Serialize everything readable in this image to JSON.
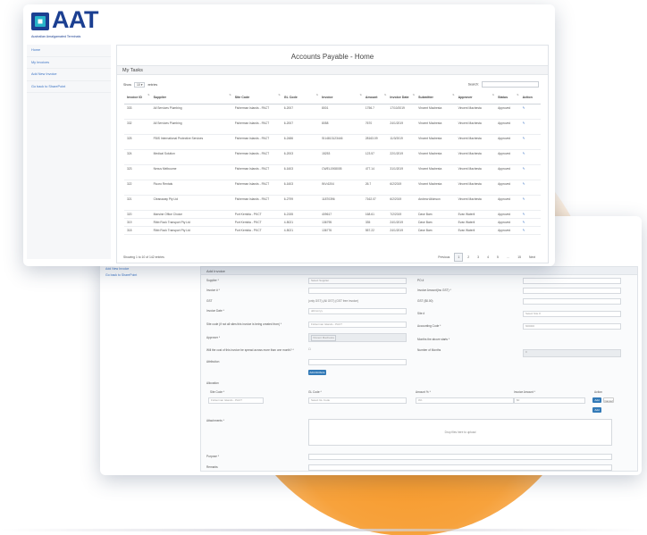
{
  "brand": {
    "name": "AAT",
    "tagline": "Australian Amalgamated Terminals",
    "colors": {
      "navy": "#1b3f91",
      "teal": "#27b3c9",
      "accent": "#f6941f"
    }
  },
  "front": {
    "sidebar": {
      "items": [
        {
          "label": "Home"
        },
        {
          "label": "My Invoices"
        },
        {
          "label": "Add New Invoice"
        },
        {
          "label": "Go back to SharePoint"
        }
      ]
    },
    "page_title": "Accounts Payable - Home",
    "section_title": "My Tasks",
    "show_label": "Show",
    "show_value": "10",
    "entries_label": "entries",
    "search_label": "Search:",
    "columns": [
      "Invoice ID",
      "Supplier",
      "Site Code",
      "GL Code",
      "Invoice",
      "Amount",
      "Invoice Date",
      "Submitter",
      "Approver",
      "Status",
      "Action"
    ],
    "rows": [
      {
        "id": "333",
        "supplier": "All Services Plumbing",
        "site": "Fisherman Islands - PACT",
        "gl": "6-2007",
        "invoice": "8001",
        "amount": "1756.7",
        "date": "17/10/2019",
        "submitter": "Vincent Machesta",
        "approver": "Vincent Machesta",
        "status": "Approved",
        "tall": true
      },
      {
        "id": "332",
        "supplier": "All Services Plumbing",
        "site": "Fisherman Islands - PACT",
        "gl": "6-2007",
        "invoice": "8058",
        "amount": "7670",
        "date": "24/1/2019",
        "submitter": "Vincent Machesta",
        "approver": "Vincent Machesta",
        "status": "Approved",
        "tall": true
      },
      {
        "id": "325",
        "supplier": "FBIS International Protective Services",
        "site": "Fisherman Islands - PACT",
        "gl": "6-2486",
        "invoice": "SI14813123446",
        "amount": "28163.09",
        "date": "11/3/2019",
        "submitter": "Vincent Machesta",
        "approver": "Vincent Machesta",
        "status": "Approved",
        "tall": true
      },
      {
        "id": "324",
        "supplier": "Medical Solution",
        "site": "Fisherman Islands - PACT",
        "gl": "6-2003",
        "invoice": "15253",
        "amount": "123.57",
        "date": "22/1/2019",
        "submitter": "Vincent Machesta",
        "approver": "Vincent Machesta",
        "status": "Approved",
        "tall": true
      },
      {
        "id": "323",
        "supplier": "Nexus Melbourne",
        "site": "Fisherman Islands - PACT",
        "gl": "6-1603",
        "invoice": "CWEL1908005",
        "amount": "477.14",
        "date": "31/1/2019",
        "submitter": "Vincent Machesta",
        "approver": "Vincent Machesta",
        "status": "Approved",
        "tall": true
      },
      {
        "id": "322",
        "supplier": "Fluoro Rentals",
        "site": "Fisherman Islands - PACT",
        "gl": "6-1603",
        "invoice": "INV-6204",
        "amount": "26.7",
        "date": "6/2/2019",
        "submitter": "Vincent Machesta",
        "approver": "Vincent Machesta",
        "status": "Approved",
        "tall": true
      },
      {
        "id": "321",
        "supplier": "Cleanaway Pty Ltd",
        "site": "Fisherman Islands - PACT",
        "gl": "6-2799",
        "invoice": "11870396",
        "amount": "7162.07",
        "date": "6/2/2019",
        "submitter": "Andrew Atkinson",
        "approver": "Vincent Machesta",
        "status": "Approved",
        "tall": true
      },
      {
        "id": "320",
        "supplier": "Marsine Office Choice",
        "site": "Port Kembla - PKCT",
        "gl": "6-2155",
        "invoice": "409617",
        "amount": "168.61",
        "date": "7/2/2019",
        "submitter": "Dave Bam",
        "approver": "Evan Waterli",
        "status": "Approved",
        "tall": false
      },
      {
        "id": "319",
        "supplier": "Ribb Rock Transport Pty Ltd",
        "site": "Port Kembla - PKCT",
        "gl": "4-5021",
        "invoice": "136795",
        "amount": "335",
        "date": "24/1/2019",
        "submitter": "Dave Bam",
        "approver": "Evan Waterli",
        "status": "Approved",
        "tall": false
      },
      {
        "id": "318",
        "supplier": "Ribb Rock Transport Pty Ltd",
        "site": "Port Kembla - PKCT",
        "gl": "4-5021",
        "invoice": "136776",
        "amount": "557.22",
        "date": "24/1/2019",
        "submitter": "Dave Bam",
        "approver": "Evan Waterli",
        "status": "Approved",
        "tall": false
      }
    ],
    "showing_text": "Showing 1 to 10 of 142 entries",
    "pager": [
      "Previous",
      "1",
      "2",
      "3",
      "4",
      "5",
      "…",
      "15",
      "Next"
    ]
  },
  "back": {
    "sidebar": [
      {
        "label": "Add New Invoice"
      },
      {
        "label": "Go back to SharePoint"
      }
    ],
    "panel_title": "Add Invoice",
    "fields_left": [
      {
        "label": "Supplier *",
        "value": "Select Supplier"
      },
      {
        "label": "Invoice # *",
        "value": ""
      },
      {
        "label": "GST",
        "value": "(only GST) (All GST) (GST free invoice)"
      },
      {
        "label": "Invoice Date *",
        "value": "dd/mm/yy"
      },
      {
        "label": "Site code (if not all sites this invoice is being created from) *",
        "value": "Fisherman Islands - PACT"
      },
      {
        "label": "Approver *",
        "value": "Vincent Machesta"
      },
      {
        "label": "Will the cost of this invoice be spread across more than one month? *",
        "value": "☐"
      },
      {
        "label": "Attribution",
        "value": ""
      }
    ],
    "fields_right": [
      {
        "label": "PO #",
        "value": ""
      },
      {
        "label": "Invoice Amount(Inc GST) *",
        "value": ""
      },
      {
        "label": "GST ($0.00)",
        "value": ""
      },
      {
        "label": "Site #",
        "value": "Select Site #"
      },
      {
        "label": "Accounting Code *",
        "value": "600000"
      },
      {
        "label": "Months the above starts *",
        "value": ""
      },
      {
        "label": "Number of Months",
        "value": "0"
      }
    ],
    "add_button": "Add Attribute",
    "allocation_title": "Allocation",
    "alloc_cols": [
      "Site Code *",
      "GL Code *",
      "Amount % *",
      "Invoice Amount *",
      "Action"
    ],
    "alloc_row": {
      "site": "Fisherman Islands - PACT",
      "gl": "Select GL Code",
      "pct": "0%",
      "amt": "$0",
      "btn1": "Add",
      "btn2": "Cancel",
      "btn3": "Add"
    },
    "attachments_label": "Attachments *",
    "dropzone_text": "Drop files here to upload",
    "purpose_label": "Purpose *",
    "remarks_label": "Remarks"
  }
}
